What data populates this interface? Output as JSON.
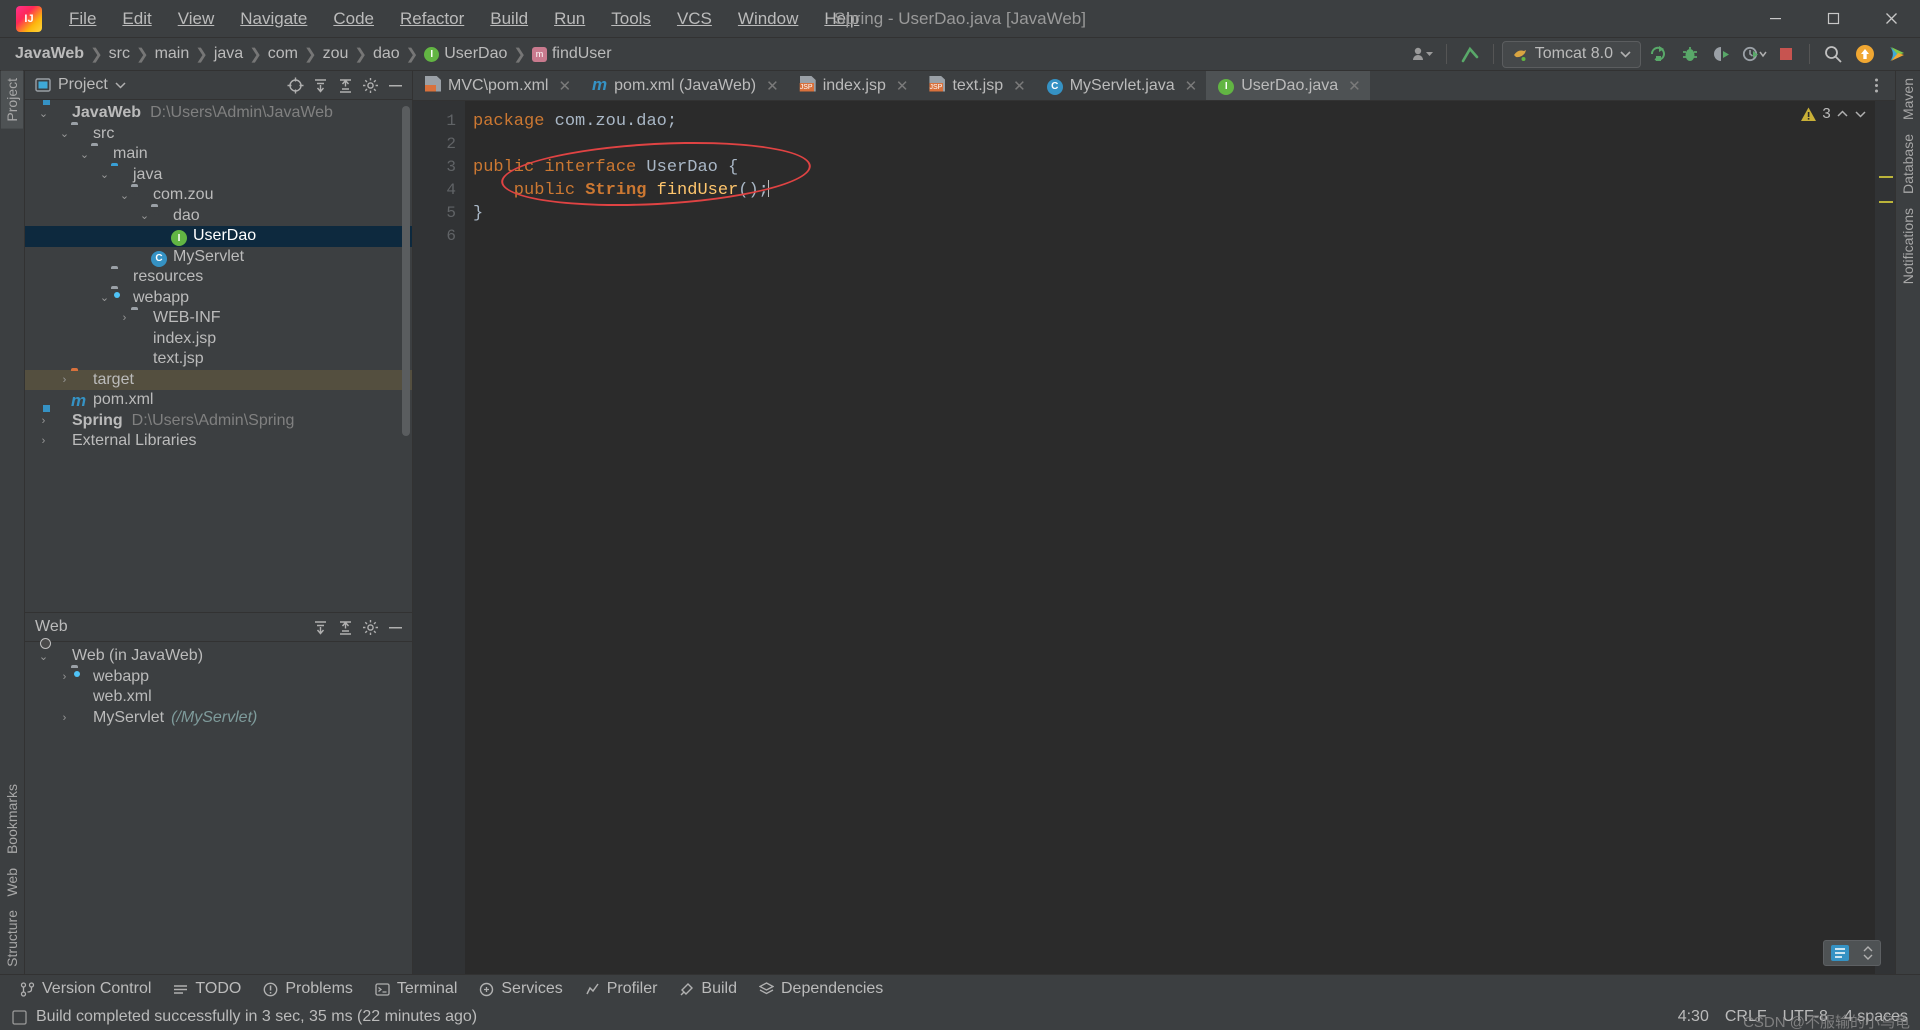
{
  "window": {
    "title": "Spring - UserDao.java [JavaWeb]",
    "logo_label": "IJ",
    "minimize": "–",
    "maximize": "❐",
    "close": "✕"
  },
  "menubar": [
    {
      "label": "File"
    },
    {
      "label": "Edit"
    },
    {
      "label": "View"
    },
    {
      "label": "Navigate"
    },
    {
      "label": "Code"
    },
    {
      "label": "Refactor"
    },
    {
      "label": "Build"
    },
    {
      "label": "Run"
    },
    {
      "label": "Tools"
    },
    {
      "label": "VCS"
    },
    {
      "label": "Window"
    },
    {
      "label": "Help"
    }
  ],
  "breadcrumb": [
    {
      "label": "JavaWeb",
      "bold": true
    },
    {
      "label": "src"
    },
    {
      "label": "main"
    },
    {
      "label": "java"
    },
    {
      "label": "com"
    },
    {
      "label": "zou"
    },
    {
      "label": "dao"
    },
    {
      "label": "UserDao",
      "icon": "interface-icon",
      "icon_char": "I"
    },
    {
      "label": "findUser",
      "icon": "method-icon",
      "icon_char": "m"
    }
  ],
  "toolbar": {
    "run_config": "Tomcat 8.0",
    "buttons": [
      {
        "name": "user-account-button",
        "title": "Account"
      },
      {
        "name": "update-project-button",
        "title": "Update Project"
      },
      {
        "name": "run-button",
        "title": "Run"
      },
      {
        "name": "debug-button",
        "title": "Debug"
      },
      {
        "name": "run-coverage-button",
        "title": "Run with Coverage"
      },
      {
        "name": "profiler-button",
        "title": "Profiler"
      },
      {
        "name": "stop-button",
        "title": "Stop"
      },
      {
        "name": "search-everywhere-button",
        "title": "Search Everywhere"
      },
      {
        "name": "updates-button",
        "title": "Updates"
      },
      {
        "name": "intellij-services-button",
        "title": "Services"
      }
    ]
  },
  "project_panel": {
    "title": "Project",
    "tree": [
      {
        "indent": 0,
        "arrow": "⌄",
        "icon": "module-icon",
        "label": "JavaWeb",
        "bold": true,
        "dim": "D:\\Users\\Admin\\JavaWeb"
      },
      {
        "indent": 1,
        "arrow": "⌄",
        "icon": "folder-grey-icon",
        "label": "src"
      },
      {
        "indent": 2,
        "arrow": "⌄",
        "icon": "folder-grey-icon",
        "label": "main"
      },
      {
        "indent": 3,
        "arrow": "⌄",
        "icon": "folder-blue-icon",
        "label": "java"
      },
      {
        "indent": 4,
        "arrow": "⌄",
        "icon": "package-icon",
        "label": "com.zou"
      },
      {
        "indent": 5,
        "arrow": "⌄",
        "icon": "package-icon",
        "label": "dao"
      },
      {
        "indent": 6,
        "arrow": "",
        "icon": "interface-icon",
        "label": "UserDao",
        "state": "selected"
      },
      {
        "indent": 5,
        "arrow": "",
        "icon": "class-icon",
        "label": "MyServlet"
      },
      {
        "indent": 3,
        "arrow": "",
        "icon": "resources-folder-icon",
        "label": "resources"
      },
      {
        "indent": 3,
        "arrow": "⌄",
        "icon": "webapp-folder-icon",
        "label": "webapp"
      },
      {
        "indent": 4,
        "arrow": "›",
        "icon": "folder-grey-icon",
        "label": "WEB-INF"
      },
      {
        "indent": 4,
        "arrow": "",
        "icon": "jsp-file-icon",
        "label": "index.jsp"
      },
      {
        "indent": 4,
        "arrow": "",
        "icon": "jsp-file-icon",
        "label": "text.jsp"
      },
      {
        "indent": 1,
        "arrow": "›",
        "icon": "folder-orange-icon",
        "label": "target",
        "state": "hovered"
      },
      {
        "indent": 2,
        "arrow": "",
        "icon": "maven-icon",
        "label": "pom.xml"
      },
      {
        "indent": 0,
        "arrow": "›",
        "icon": "module-icon",
        "label": "Spring",
        "bold": true,
        "dim": "D:\\Users\\Admin\\Spring"
      },
      {
        "indent": 0,
        "arrow": "›",
        "icon": "libraries-icon",
        "label": "External Libraries"
      }
    ]
  },
  "web_panel": {
    "title": "Web",
    "tree": [
      {
        "indent": 0,
        "arrow": "⌄",
        "icon": "web-facet-icon",
        "label": "Web (in JavaWeb)"
      },
      {
        "indent": 1,
        "arrow": "›",
        "icon": "webapp-folder-icon",
        "label": "webapp"
      },
      {
        "indent": 1,
        "arrow": "",
        "icon": "xml-file-icon",
        "label": "web.xml"
      },
      {
        "indent": 1,
        "arrow": "›",
        "icon": "servlet-icon",
        "label": "MyServlet",
        "ital": "(/MyServlet)"
      }
    ]
  },
  "left_rail": [
    {
      "label": "Project",
      "name": "rail-project",
      "state": "selected"
    },
    {
      "label": "Bookmarks",
      "name": "rail-bookmarks"
    },
    {
      "label": "Web",
      "name": "rail-web"
    },
    {
      "label": "Structure",
      "name": "rail-structure"
    }
  ],
  "right_rail": [
    {
      "label": "Maven",
      "name": "rail-maven"
    },
    {
      "label": "Database",
      "name": "rail-database"
    },
    {
      "label": "Notifications",
      "name": "rail-notifications"
    }
  ],
  "editor_tabs": [
    {
      "label": "MVC\\pom.xml",
      "icon": "xml-file-icon",
      "active": false
    },
    {
      "label": "pom.xml (JavaWeb)",
      "icon": "maven-icon",
      "active": false
    },
    {
      "label": "index.jsp",
      "icon": "jsp-file-icon",
      "active": false
    },
    {
      "label": "text.jsp",
      "icon": "jsp-file-icon",
      "active": false
    },
    {
      "label": "MyServlet.java",
      "icon": "class-icon",
      "active": false
    },
    {
      "label": "UserDao.java",
      "icon": "interface-icon",
      "active": true
    }
  ],
  "editor": {
    "line_numbers": [
      "1",
      "2",
      "3",
      "4",
      "5",
      "6"
    ],
    "code": [
      [
        {
          "t": "package",
          "c": "kw"
        },
        {
          "t": " com.zou.dao;",
          "c": "pl"
        }
      ],
      [],
      [
        {
          "t": "public interface",
          "c": "kw"
        },
        {
          "t": " UserDao {",
          "c": "pl"
        }
      ],
      [
        {
          "t": "    public",
          "c": "kw"
        },
        {
          "t": " String",
          "c": "kw-b"
        },
        {
          "t": " ",
          "c": "pl"
        },
        {
          "t": "findUser",
          "c": "mth"
        },
        {
          "t": "();",
          "c": "pl"
        }
      ],
      [
        {
          "t": "}",
          "c": "pl"
        }
      ],
      []
    ],
    "warning_count": "3"
  },
  "bottom_tabs": [
    {
      "label": "Version Control",
      "icon": "vcs-icon"
    },
    {
      "label": "TODO",
      "icon": "todo-icon"
    },
    {
      "label": "Problems",
      "icon": "problems-icon"
    },
    {
      "label": "Terminal",
      "icon": "terminal-icon"
    },
    {
      "label": "Services",
      "icon": "services-icon"
    },
    {
      "label": "Profiler",
      "icon": "profiler-icon"
    },
    {
      "label": "Build",
      "icon": "build-icon"
    },
    {
      "label": "Dependencies",
      "icon": "dependencies-icon"
    }
  ],
  "status": {
    "message": "Build completed successfully in 3 sec, 35 ms (22 minutes ago)",
    "caret": "4:30",
    "line_separator": "CRLF",
    "encoding": "UTF-8",
    "indent": "4 spaces",
    "watermark": "CSDN @不服输的小乌龟"
  },
  "colors": {
    "accent_blue": "#3592c4",
    "selection": "#0d293e",
    "green": "#62b543",
    "orange": "#cc7832",
    "annotation_red": "#e04343",
    "warn_yellow": "#bbb43a"
  }
}
